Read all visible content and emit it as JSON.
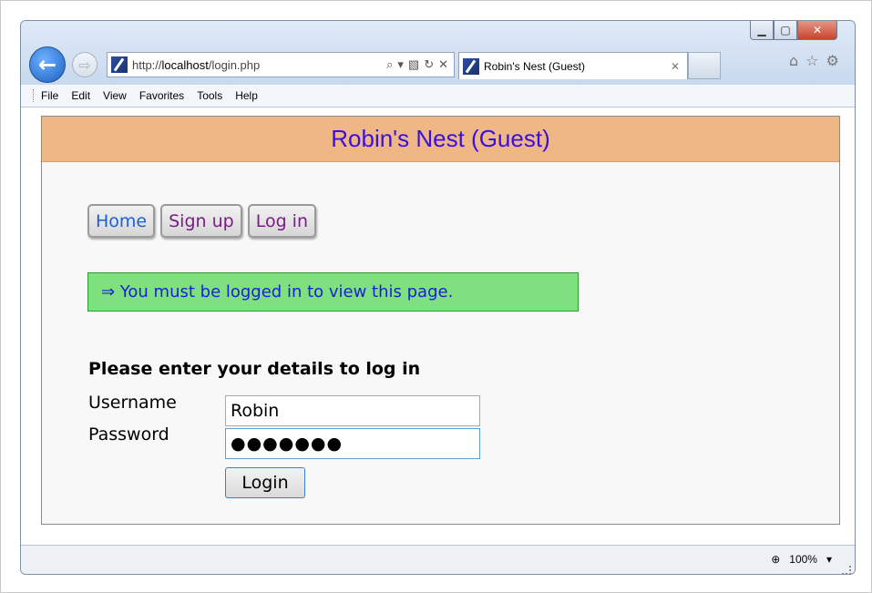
{
  "browser": {
    "url_prefix": "http://",
    "url_host": "localhost",
    "url_path": "/login.php",
    "tab_title": "Robin's Nest (Guest)",
    "window_controls": {
      "minimize": "–",
      "maximize": "□",
      "close": "X"
    },
    "menu": [
      "File",
      "Edit",
      "View",
      "Favorites",
      "Tools",
      "Help"
    ],
    "zoom": "100%"
  },
  "page": {
    "header_title": "Robin's Nest (Guest)",
    "nav": {
      "home": "Home",
      "signup": "Sign up",
      "login": "Log in"
    },
    "notice": "⇒ You must be logged in to view this page.",
    "form_heading": "Please enter your details to log in",
    "username_label": "Username",
    "username_value": "Robin",
    "password_label": "Password",
    "password_value": "●●●●●●●",
    "login_button": "Login"
  },
  "colors": {
    "header_bg": "#efb686",
    "header_text": "#3a10e0",
    "notice_bg": "#7fe07f",
    "notice_text": "#1a20d8",
    "link_home": "#1b5fd6",
    "link_visited": "#7a1c86"
  },
  "icons": [
    "back-arrow-icon",
    "forward-arrow-icon",
    "site-favicon",
    "search-icon",
    "dropdown-icon",
    "compat-view-icon",
    "refresh-icon",
    "stop-icon",
    "tab-close-icon",
    "home-icon",
    "favorites-star-icon",
    "settings-gear-icon",
    "zoom-icon"
  ]
}
